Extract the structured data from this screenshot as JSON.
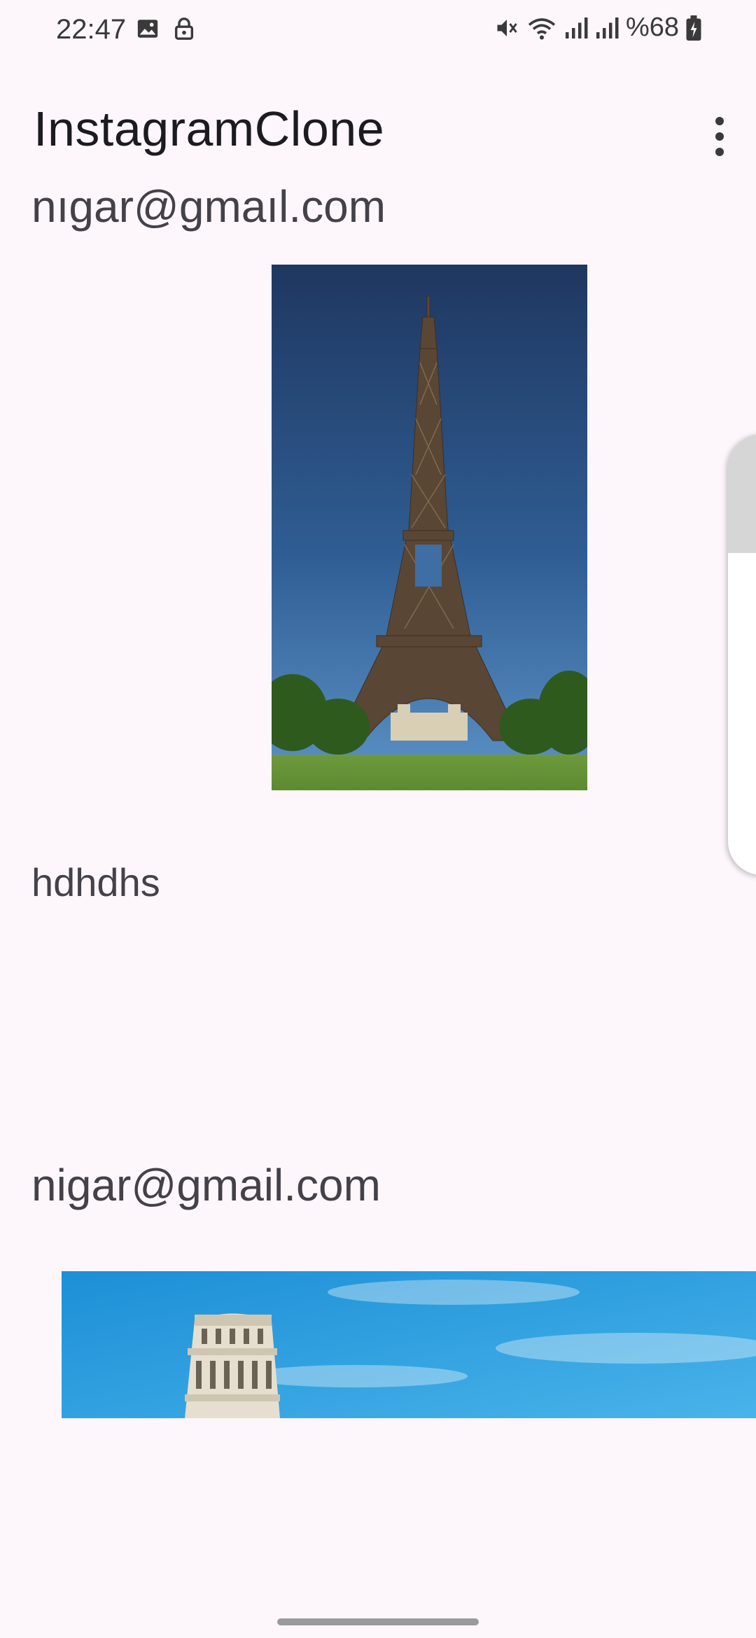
{
  "status_bar": {
    "time": "22:47",
    "battery_text": "%68",
    "icons": [
      "gallery-icon",
      "lock-icon",
      "mute-icon",
      "wifi-icon",
      "signal-icon",
      "signal-icon",
      "battery-charging-icon"
    ]
  },
  "app_bar": {
    "title": "InstagramClone",
    "menu_icon": "more-vert-icon"
  },
  "feed": {
    "posts": [
      {
        "email": "nıgar@gmaıl.com",
        "caption": "hdhdhs",
        "image": "eiffel-tower-photo"
      },
      {
        "email": "nigar@gmail.com",
        "caption": "",
        "image": "leaning-tower-pisa-photo"
      }
    ]
  },
  "colors": {
    "background": "#fdf7fc",
    "text_primary": "#1c1b1f",
    "text_secondary": "#444148"
  }
}
